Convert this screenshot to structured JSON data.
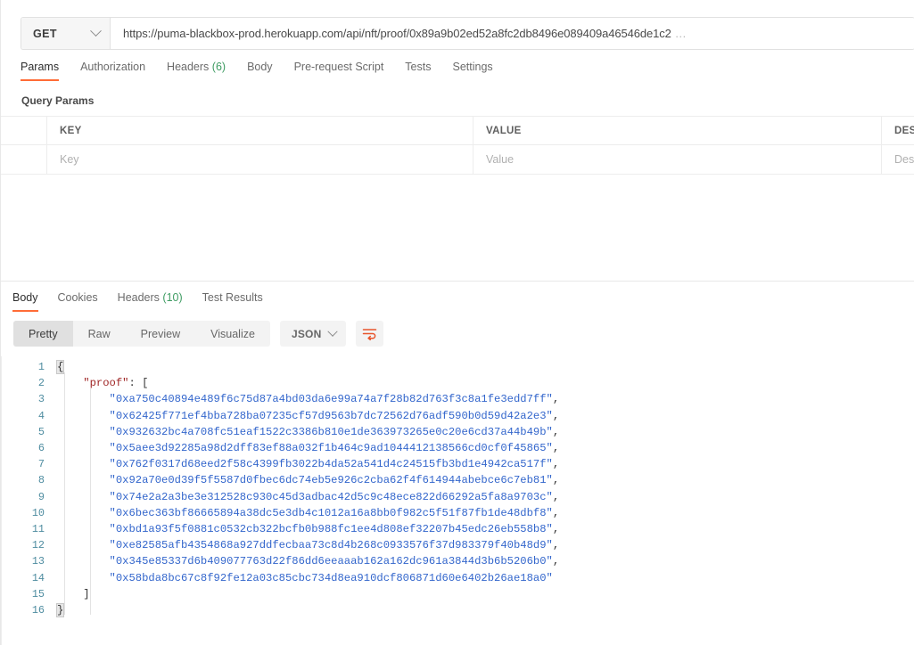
{
  "request": {
    "method": "GET",
    "method_icon": "chevron-down-icon",
    "url": "https://puma-blackbox-prod.herokuapp.com/api/nft/proof/0x89a9b02ed52a8fc2db8496e089409a46546de1c2",
    "url_ellipsis": "…",
    "tabs": [
      {
        "label": "Params",
        "active": true
      },
      {
        "label": "Authorization",
        "active": false
      },
      {
        "label": "Headers",
        "count": "(6)",
        "active": false
      },
      {
        "label": "Body",
        "active": false
      },
      {
        "label": "Pre-request Script",
        "active": false
      },
      {
        "label": "Tests",
        "active": false
      },
      {
        "label": "Settings",
        "active": false
      }
    ],
    "section_title": "Query Params",
    "table": {
      "headers": [
        "KEY",
        "VALUE",
        "DESCRIPTION"
      ],
      "placeholder_row": [
        "Key",
        "Value",
        "Description"
      ]
    }
  },
  "response": {
    "tabs": [
      {
        "label": "Body",
        "active": true
      },
      {
        "label": "Cookies",
        "active": false
      },
      {
        "label": "Headers",
        "count": "(10)",
        "active": false
      },
      {
        "label": "Test Results",
        "active": false
      }
    ],
    "view_modes": [
      {
        "label": "Pretty",
        "active": true
      },
      {
        "label": "Raw",
        "active": false
      },
      {
        "label": "Preview",
        "active": false
      },
      {
        "label": "Visualize",
        "active": false
      }
    ],
    "format": "JSON",
    "format_icon": "chevron-down-icon",
    "wrap_icon": "word-wrap-icon",
    "accent_color": "#ff6c37",
    "count_color": "#3f9c63",
    "code_lines": [
      {
        "n": "1",
        "indent": 0,
        "kind": "brace-open",
        "text": "{"
      },
      {
        "n": "2",
        "indent": 1,
        "kind": "key-array",
        "key": "\"proof\"",
        "text": ": ["
      },
      {
        "n": "3",
        "indent": 2,
        "kind": "string",
        "text": "\"0xa750c40894e489f6c75d87a4bd03da6e99a74a7f28b82d763f3c8a1fe3edd7ff\"",
        "comma": ","
      },
      {
        "n": "4",
        "indent": 2,
        "kind": "string",
        "text": "\"0x62425f771ef4bba728ba07235cf57d9563b7dc72562d76adf590b0d59d42a2e3\"",
        "comma": ","
      },
      {
        "n": "5",
        "indent": 2,
        "kind": "string",
        "text": "\"0x932632bc4a708fc51eaf1522c3386b810e1de363973265e0c20e6cd37a44b49b\"",
        "comma": ","
      },
      {
        "n": "6",
        "indent": 2,
        "kind": "string",
        "text": "\"0x5aee3d92285a98d2dff83ef88a032f1b464c9ad1044412138566cd0cf0f45865\"",
        "comma": ","
      },
      {
        "n": "7",
        "indent": 2,
        "kind": "string",
        "text": "\"0x762f0317d68eed2f58c4399fb3022b4da52a541d4c24515fb3bd1e4942ca517f\"",
        "comma": ","
      },
      {
        "n": "8",
        "indent": 2,
        "kind": "string",
        "text": "\"0x92a70e0d39f5f5587d0fbec6dc74eb5e926c2cba62f4f614944abebce6c7eb81\"",
        "comma": ","
      },
      {
        "n": "9",
        "indent": 2,
        "kind": "string",
        "text": "\"0x74e2a2a3be3e312528c930c45d3adbac42d5c9c48ece822d66292a5fa8a9703c\"",
        "comma": ","
      },
      {
        "n": "10",
        "indent": 2,
        "kind": "string",
        "text": "\"0x6bec363bf86665894a38dc5e3db4c1012a16a8bb0f982c5f51f87fb1de48dbf8\"",
        "comma": ","
      },
      {
        "n": "11",
        "indent": 2,
        "kind": "string",
        "text": "\"0xbd1a93f5f0881c0532cb322bcfb0b988fc1ee4d808ef32207b45edc26eb558b8\"",
        "comma": ","
      },
      {
        "n": "12",
        "indent": 2,
        "kind": "string",
        "text": "\"0xe82585afb4354868a927ddfecbaa73c8d4b268c0933576f37d983379f40b48d9\"",
        "comma": ","
      },
      {
        "n": "13",
        "indent": 2,
        "kind": "string",
        "text": "\"0x345e85337d6b409077763d22f86dd6eeaaab162a162dc961a3844d3b6b5206b0\"",
        "comma": ","
      },
      {
        "n": "14",
        "indent": 2,
        "kind": "string",
        "text": "\"0x58bda8bc67c8f92fe12a03c85cbc734d8ea910dcf806871d60e6402b26ae18a0\"",
        "comma": ""
      },
      {
        "n": "15",
        "indent": 1,
        "kind": "bracket-close",
        "text": "]"
      },
      {
        "n": "16",
        "indent": 0,
        "kind": "brace-close",
        "text": "}"
      }
    ]
  }
}
